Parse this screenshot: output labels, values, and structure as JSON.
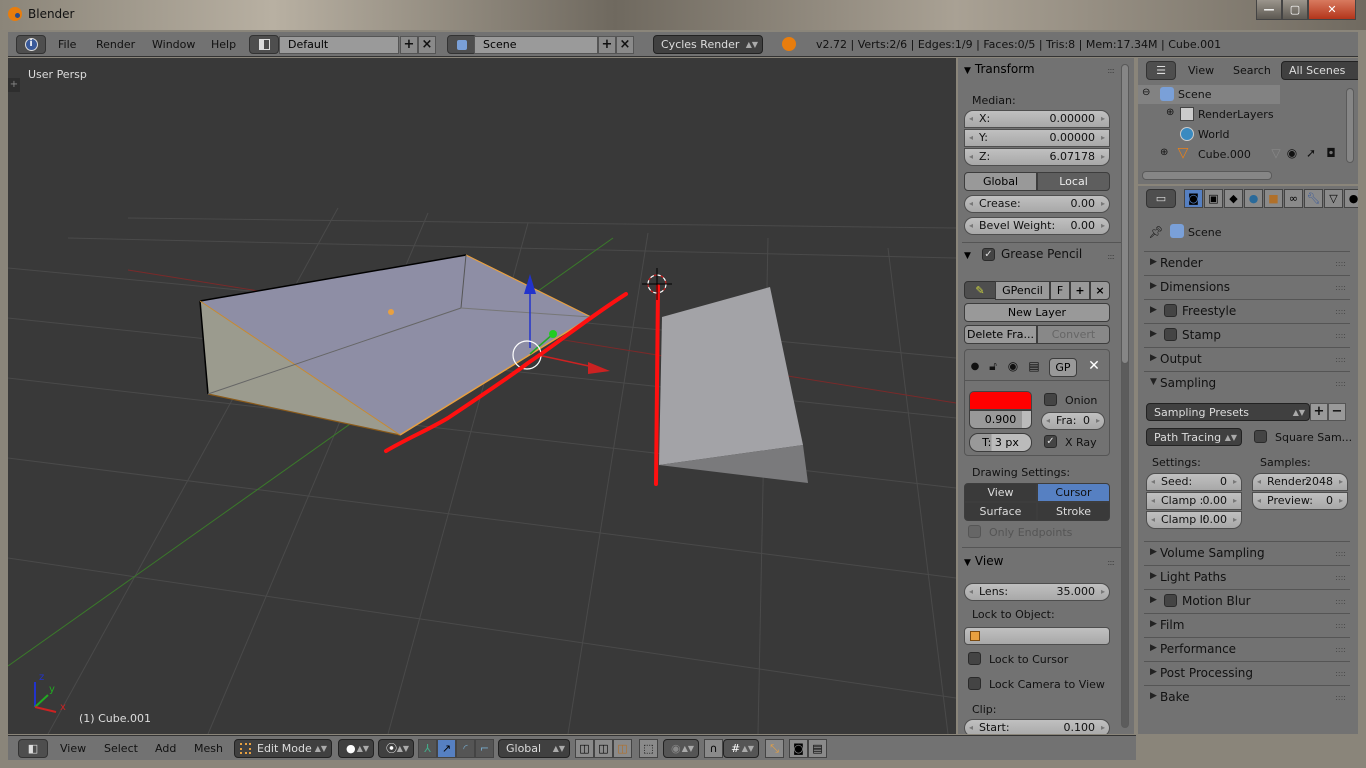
{
  "window": {
    "title": "Blender",
    "controls": {
      "minimize": "—",
      "maximize": "▢",
      "close": "✕"
    }
  },
  "info_header": {
    "menus": [
      "File",
      "Render",
      "Window",
      "Help"
    ],
    "screen_layout": "Default",
    "scene": "Scene",
    "render_engine": "Cycles Render",
    "stats": "v2.72 | Verts:2/6 | Edges:1/9 | Faces:0/5 | Tris:8 | Mem:17.34M | Cube.001"
  },
  "viewport": {
    "view_name": "User Persp",
    "object_label": "(1) Cube.001",
    "axes": {
      "x": "x",
      "y": "y",
      "z": "z"
    }
  },
  "n_panel": {
    "transform": {
      "title": "Transform",
      "median_label": "Median:",
      "x": {
        "label": "X:",
        "value": "0.00000"
      },
      "y": {
        "label": "Y:",
        "value": "0.00000"
      },
      "z": {
        "label": "Z:",
        "value": "6.07178"
      },
      "global": "Global",
      "local": "Local",
      "crease": {
        "label": "Crease:",
        "value": "0.00"
      },
      "bevel_weight": {
        "label": "Bevel Weight:",
        "value": "0.00"
      }
    },
    "grease_pencil": {
      "title": "Grease Pencil",
      "enabled": true,
      "datablock": "GPencil",
      "fake_user": "F",
      "new_layer": "New Layer",
      "delete_frame": "Delete Fra...",
      "convert": "Convert",
      "layer_name": "GP",
      "color": "#ff0000",
      "opacity": "0.900",
      "thickness": "T: 3 px",
      "onion_label": "Onion",
      "onion": false,
      "frames": {
        "label": "Fra:",
        "value": "0"
      },
      "xray_label": "X Ray",
      "xray": true,
      "drawing_settings_label": "Drawing Settings:",
      "draw_modes": [
        "View",
        "Cursor",
        "Surface",
        "Stroke"
      ],
      "active_draw_mode": "Cursor",
      "only_endpoints": "Only Endpoints"
    },
    "view": {
      "title": "View",
      "lens": {
        "label": "Lens:",
        "value": "35.000"
      },
      "lock_to_object_label": "Lock to Object:",
      "lock_to_cursor": "Lock to Cursor",
      "lock_camera_to_view": "Lock Camera to View",
      "clip_label": "Clip:",
      "clip_start": {
        "label": "Start:",
        "value": "0.100"
      }
    }
  },
  "outliner": {
    "menus": [
      "View",
      "Search"
    ],
    "display_mode": "All Scenes",
    "items": [
      {
        "name": "Scene",
        "icon": "scene-icon"
      },
      {
        "name": "RenderLayers",
        "icon": "renderlayers-icon"
      },
      {
        "name": "World",
        "icon": "world-icon"
      },
      {
        "name": "Cube.000",
        "icon": "mesh-icon"
      }
    ]
  },
  "properties": {
    "context": "Scene",
    "tabs": [
      "render",
      "render-layers",
      "scene",
      "world",
      "object",
      "constraints",
      "modifiers",
      "data",
      "material"
    ],
    "active_tab": "render",
    "panels_top": [
      {
        "label": "Render",
        "checkbox": false
      },
      {
        "label": "Dimensions",
        "checkbox": false
      },
      {
        "label": "Freestyle",
        "checkbox": true
      },
      {
        "label": "Stamp",
        "checkbox": true
      },
      {
        "label": "Output",
        "checkbox": false
      }
    ],
    "sampling": {
      "title": "Sampling",
      "presets": "Sampling Presets",
      "integrator": "Path Tracing",
      "square_samples": "Square Sam...",
      "settings_label": "Settings:",
      "seed": {
        "label": "Seed:",
        "value": "0"
      },
      "clamp_direct": {
        "label": "Clamp :",
        "value": "0.00"
      },
      "clamp_indirect": {
        "label": "Clamp I:",
        "value": "0.00"
      },
      "samples_label": "Samples:",
      "render": {
        "label": "Render:",
        "value": "2048"
      },
      "preview": {
        "label": "Preview:",
        "value": "0"
      }
    },
    "panels_bottom": [
      {
        "label": "Volume Sampling",
        "checkbox": false
      },
      {
        "label": "Light Paths",
        "checkbox": false
      },
      {
        "label": "Motion Blur",
        "checkbox": true
      },
      {
        "label": "Film",
        "checkbox": false
      },
      {
        "label": "Performance",
        "checkbox": false
      },
      {
        "label": "Post Processing",
        "checkbox": false
      },
      {
        "label": "Bake",
        "checkbox": false
      }
    ]
  },
  "view3d_header": {
    "menus": [
      "View",
      "Select",
      "Add",
      "Mesh"
    ],
    "mode": "Edit Mode",
    "transform_orientation": "Global"
  }
}
